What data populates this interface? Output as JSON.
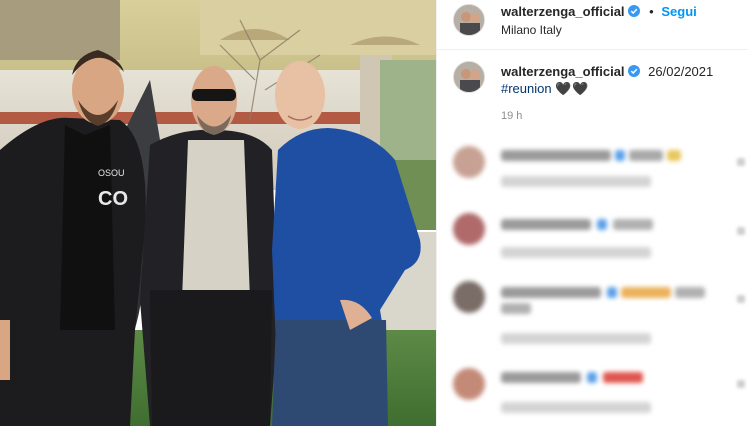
{
  "post": {
    "username": "walterzenga_official",
    "follow_label": "Segui",
    "separator": "•",
    "location": "Milano Italy"
  },
  "caption": {
    "username": "walterzenga_official",
    "date": "26/02/2021",
    "hashtag": "#reunion",
    "hearts": "🖤🖤",
    "time_ago": "19 h"
  },
  "colors": {
    "link_blue": "#0095f6",
    "hashtag_blue": "#00376b",
    "verified_blue": "#3897f0",
    "muted_gray": "#8e8e8e"
  },
  "icons": [
    "verified-badge-icon"
  ]
}
